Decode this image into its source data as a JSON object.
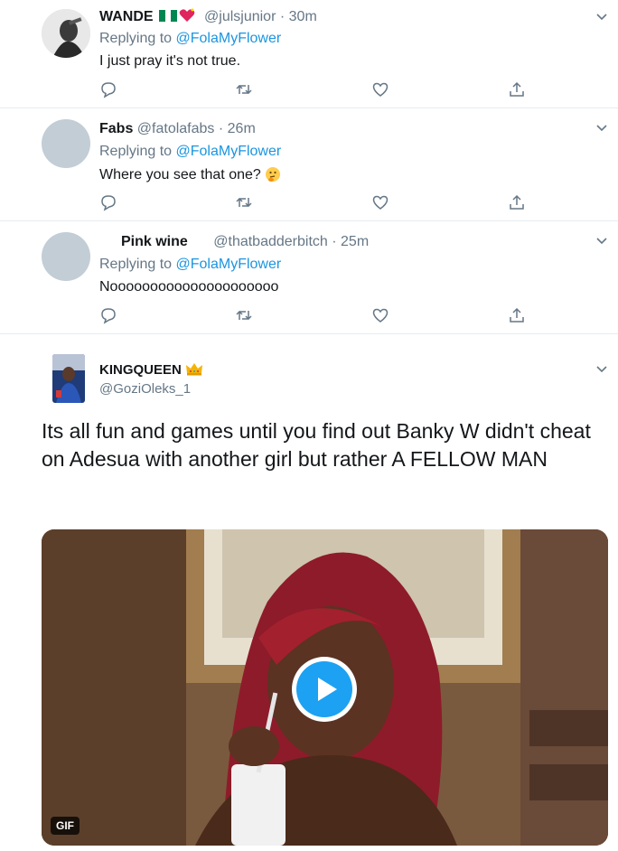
{
  "replies": [
    {
      "name": "WANDE",
      "handle": "@julsjunior",
      "separator": "·",
      "time": "30m",
      "replying_prefix": "Replying to",
      "replying_to": "@FolaMyFlower",
      "text": "I just pray it's not true.",
      "emoji": [
        "nigeria-flag",
        "sparkling-heart"
      ]
    },
    {
      "name": "Fabs",
      "handle": "@fatolafabs",
      "separator": "·",
      "time": "26m",
      "replying_prefix": "Replying to",
      "replying_to": "@FolaMyFlower",
      "text": "Where you see that one?",
      "emoji": [
        "thinking-face"
      ]
    },
    {
      "name": "Pink wine",
      "handle": "@thatbadderbitch",
      "separator": "·",
      "time": "25m",
      "replying_prefix": "Replying to",
      "replying_to": "@FolaMyFlower",
      "text": "Nooooooooooooooooooooo"
    }
  ],
  "main_tweet": {
    "name": "KINGQUEEN",
    "handle": "@GoziOleks_1",
    "emoji": "crown",
    "text": "Its all fun and games until you find out Banky W didn't cheat on Adesua with another girl but rather A FELLOW MAN",
    "media": {
      "badge": "GIF"
    }
  },
  "colors": {
    "link": "#1b95e0",
    "secondary": "#657786",
    "text": "#14171a",
    "border": "#e6ecf0",
    "play": "#1da1f2"
  },
  "icons": [
    "reply-icon",
    "retweet-icon",
    "like-icon",
    "share-icon",
    "chevron-down-icon",
    "play-icon"
  ]
}
